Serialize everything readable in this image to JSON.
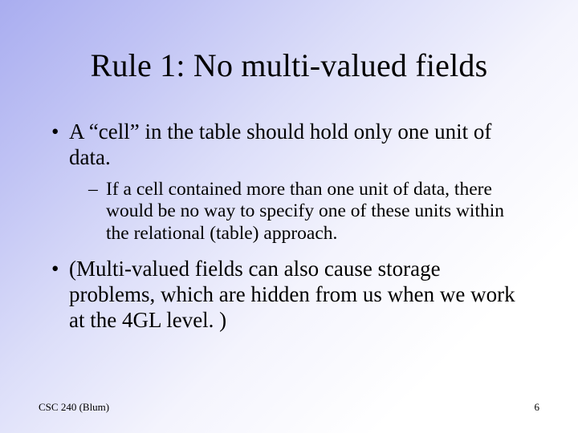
{
  "title": "Rule 1: No multi-valued fields",
  "bullets": {
    "b1": "A “cell” in the table should hold only one unit of data.",
    "b1_sub": "If a cell contained more than one unit of data, there would be no way to specify one of these units within the relational (table) approach.",
    "b2": "(Multi-valued fields can also cause storage problems, which are hidden from us when we work at the 4GL level. )"
  },
  "footer": {
    "left": "CSC 240 (Blum)",
    "right": "6"
  }
}
